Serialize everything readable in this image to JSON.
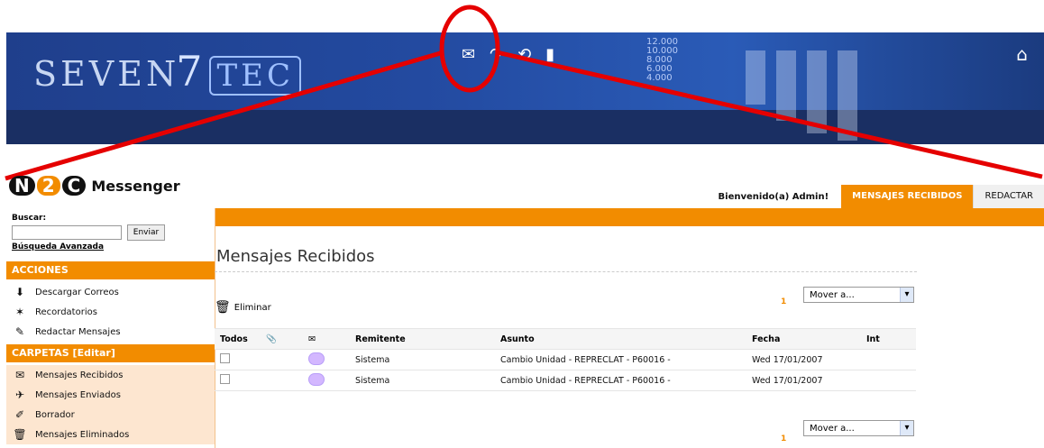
{
  "banner": {
    "logo_text_1": "SEVEN",
    "logo_text_2": "7",
    "logo_text_3": "TEC",
    "icons": [
      "mail-icon",
      "redo-icon",
      "refresh-icon",
      "door-icon"
    ],
    "chart_labels": [
      "12.000",
      "10.000",
      "8.000",
      "6.000",
      "4.000"
    ],
    "home_icon": "home-icon"
  },
  "annotation": {
    "color": "#e50000"
  },
  "app": {
    "brand_prefix": "N2C",
    "brand_name": "Messenger",
    "welcome": "Bienvenido(a) Admin!",
    "tabs": [
      {
        "label": "MENSAJES RECIBIDOS",
        "active": true
      },
      {
        "label": "REDACTAR",
        "active": false
      }
    ]
  },
  "sidebar": {
    "search": {
      "label": "Buscar:",
      "placeholder": "",
      "button": "Enviar",
      "advanced": "Búsqueda Avanzada"
    },
    "sections": [
      {
        "title": "ACCIONES",
        "items": [
          {
            "label": "Descargar Correos",
            "icon": "download-mail-icon"
          },
          {
            "label": "Recordatorios",
            "icon": "reminder-icon"
          },
          {
            "label": "Redactar Mensajes",
            "icon": "compose-icon"
          }
        ]
      },
      {
        "title": "CARPETAS [Editar]",
        "items": [
          {
            "label": "Mensajes Recibidos",
            "icon": "inbox-icon"
          },
          {
            "label": "Mensajes Enviados",
            "icon": "sent-icon"
          },
          {
            "label": "Borrador",
            "icon": "draft-icon"
          },
          {
            "label": "Mensajes Eliminados",
            "icon": "trash-icon"
          }
        ]
      }
    ]
  },
  "main": {
    "title": "Mensajes Recibidos",
    "toolbar": {
      "delete": "Eliminar"
    },
    "pager": "1",
    "move_to": "Mover a...",
    "table": {
      "headers": [
        "Todos",
        "",
        "",
        "Remitente",
        "Asunto",
        "Fecha",
        "Int"
      ],
      "rows": [
        {
          "remitente": "Sistema",
          "asunto": "Cambio Unidad - REPRECLAT - P60016 -",
          "fecha": "Wed 17/01/2007"
        },
        {
          "remitente": "Sistema",
          "asunto": "Cambio Unidad - REPRECLAT - P60016 -",
          "fecha": "Wed 17/01/2007"
        }
      ]
    }
  }
}
